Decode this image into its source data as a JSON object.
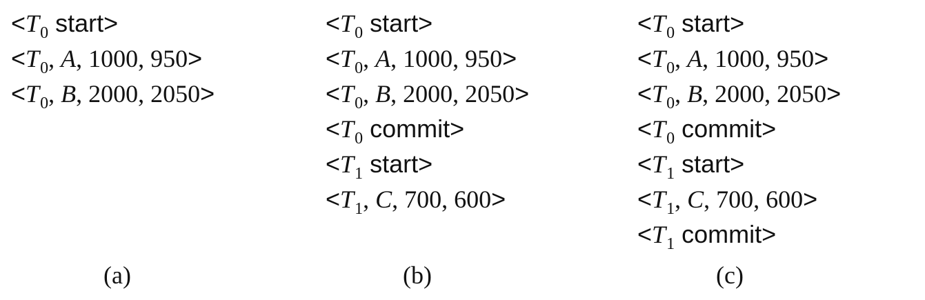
{
  "logs": [
    {
      "caption": "(a)",
      "records": [
        {
          "kind": "start",
          "tx": "T",
          "sub": "0",
          "keyword": "start"
        },
        {
          "kind": "update",
          "tx": "T",
          "sub": "0",
          "item": "A",
          "old": "1000",
          "new": "950"
        },
        {
          "kind": "update",
          "tx": "T",
          "sub": "0",
          "item": "B",
          "old": "2000",
          "new": "2050"
        }
      ]
    },
    {
      "caption": "(b)",
      "records": [
        {
          "kind": "start",
          "tx": "T",
          "sub": "0",
          "keyword": "start"
        },
        {
          "kind": "update",
          "tx": "T",
          "sub": "0",
          "item": "A",
          "old": "1000",
          "new": "950"
        },
        {
          "kind": "update",
          "tx": "T",
          "sub": "0",
          "item": "B",
          "old": "2000",
          "new": "2050"
        },
        {
          "kind": "commit",
          "tx": "T",
          "sub": "0",
          "keyword": "commit"
        },
        {
          "kind": "start",
          "tx": "T",
          "sub": "1",
          "keyword": "start"
        },
        {
          "kind": "update",
          "tx": "T",
          "sub": "1",
          "item": "C",
          "old": "700",
          "new": "600"
        }
      ]
    },
    {
      "caption": "(c)",
      "records": [
        {
          "kind": "start",
          "tx": "T",
          "sub": "0",
          "keyword": "start"
        },
        {
          "kind": "update",
          "tx": "T",
          "sub": "0",
          "item": "A",
          "old": "1000",
          "new": "950"
        },
        {
          "kind": "update",
          "tx": "T",
          "sub": "0",
          "item": "B",
          "old": "2000",
          "new": "2050"
        },
        {
          "kind": "commit",
          "tx": "T",
          "sub": "0",
          "keyword": "commit"
        },
        {
          "kind": "start",
          "tx": "T",
          "sub": "1",
          "keyword": "start"
        },
        {
          "kind": "update",
          "tx": "T",
          "sub": "1",
          "item": "C",
          "old": "700",
          "new": "600"
        },
        {
          "kind": "commit",
          "tx": "T",
          "sub": "1",
          "keyword": "commit"
        }
      ]
    }
  ]
}
